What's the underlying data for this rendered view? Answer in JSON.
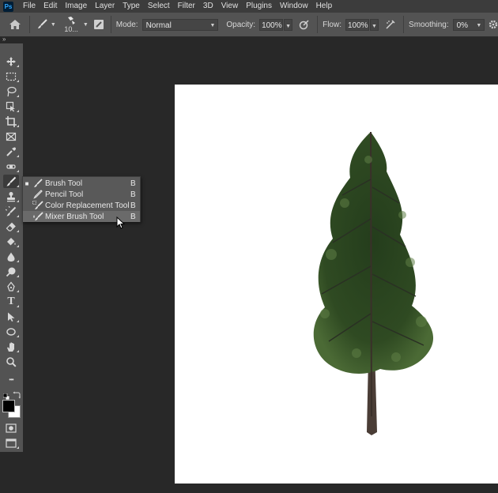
{
  "app": {
    "logo": "Ps"
  },
  "menubar": {
    "items": [
      "File",
      "Edit",
      "Image",
      "Layer",
      "Type",
      "Select",
      "Filter",
      "3D",
      "View",
      "Plugins",
      "Window",
      "Help"
    ]
  },
  "options": {
    "brush_size": "10...",
    "mode_label": "Mode:",
    "mode_value": "Normal",
    "opacity_label": "Opacity:",
    "opacity_value": "100%",
    "flow_label": "Flow:",
    "flow_value": "100%",
    "smoothing_label": "Smoothing:",
    "smoothing_value": "0%"
  },
  "collapse_glyph": "»",
  "toolbar": {
    "tools": [
      "move-tool",
      "marquee-tool",
      "lasso-tool",
      "object-selection-tool",
      "crop-tool",
      "frame-tool",
      "eyedropper-tool",
      "spot-healing-tool",
      "brush-tool",
      "clone-stamp-tool",
      "history-brush-tool",
      "eraser-tool",
      "paint-bucket-tool",
      "blur-tool",
      "dodge-tool",
      "pen-tool",
      "type-tool",
      "path-selection-tool",
      "ellipse-tool",
      "hand-tool",
      "zoom-tool",
      "edit-toolbar",
      "default-colors",
      "swap-colors",
      "color-swatches",
      "quick-mask",
      "screen-mode"
    ],
    "type_glyph": "T",
    "more_glyph": "•••",
    "foreground_color": "#000000",
    "background_color": "#ffffff"
  },
  "flyout": {
    "items": [
      {
        "label": "Brush Tool",
        "shortcut": "B",
        "active": "■"
      },
      {
        "label": "Pencil Tool",
        "shortcut": "B",
        "active": ""
      },
      {
        "label": "Color Replacement Tool",
        "shortcut": "B",
        "active": ""
      },
      {
        "label": "Mixer Brush Tool",
        "shortcut": "B",
        "active": ""
      }
    ]
  },
  "colors": {
    "canvas_bg": "#ffffff",
    "workspace_bg": "#282828",
    "panel_bg": "#535353",
    "menubar_bg": "#3c3c3c"
  }
}
